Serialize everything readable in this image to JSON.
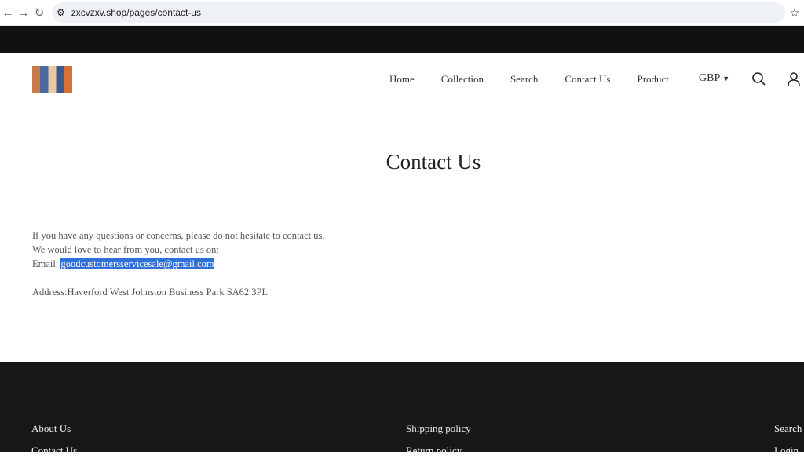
{
  "browser": {
    "url": "zxcvzxv.shop/pages/contact-us"
  },
  "header": {
    "menu": [
      "Home",
      "Collection",
      "Search",
      "Contact Us",
      "Product"
    ],
    "currency": "GBP"
  },
  "page": {
    "title": "Contact Us",
    "line1": "If you have any questions or concerns, please do not hesitate to contact us.",
    "line2": "We would love to hear from you, contact us on:",
    "email_label": "Email: ",
    "email": "goodcustomersservicesale@gmail.com",
    "address": "Address:Haverford West Johnston Business Park SA62 3PL"
  },
  "footer": {
    "col1": [
      "About Us",
      "Contact Us"
    ],
    "col2": [
      "Shipping policy",
      "Return policy"
    ],
    "col3": [
      "Search",
      "Login"
    ]
  },
  "colors": {
    "selection": "#2f6fd8",
    "footer_bg": "#181617",
    "announce_bg": "#111111"
  }
}
